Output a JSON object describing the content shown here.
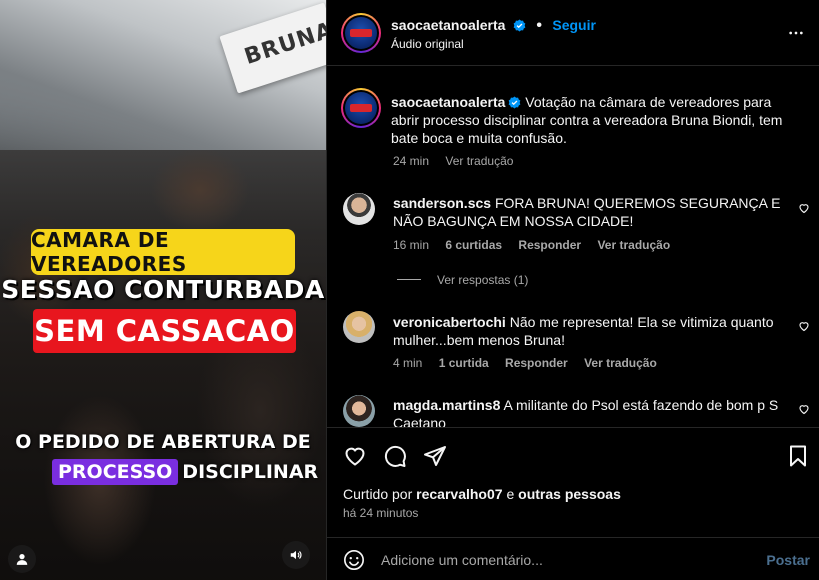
{
  "video": {
    "sign_text": "BRUNA",
    "banner_line1": "CAMARA DE VEREADORES",
    "banner_line2": "SESSAO CONTURBADA",
    "banner_line3": "SEM CASSACAO",
    "caption_line1": "O PEDIDO DE ABERTURA DE",
    "caption_highlight": "PROCESSO",
    "caption_rest": "DISCIPLINAR",
    "user_icon": "user-icon",
    "sound_icon": "speaker-icon"
  },
  "header": {
    "username": "saocaetanoalerta",
    "separator": "•",
    "follow_label": "Seguir",
    "audio_label": "Áudio original",
    "more_icon": "more-horizontal-icon"
  },
  "caption": {
    "username": "saocaetanoalerta",
    "text": "Votação na câmara de vereadores para abrir processo disciplinar contra a vereadora Bruna Biondi, tem bate boca e muita confusão.",
    "time": "24 min",
    "translate": "Ver tradução"
  },
  "comments": [
    {
      "username": "sanderson.scs",
      "text": "FORA BRUNA! QUEREMOS SEGURANÇA E NÃO BAGUNÇA EM NOSSA CIDADE!",
      "time": "16 min",
      "likes": "6 curtidas",
      "reply": "Responder",
      "translate": "Ver tradução",
      "replies_label": "Ver respostas (1)"
    },
    {
      "username": "veronicabertochi",
      "text": "Não me representa! Ela se vitimiza quanto mulher...bem menos Bruna!",
      "time": "4 min",
      "likes": "1 curtida",
      "reply": "Responder",
      "translate": "Ver tradução"
    },
    {
      "username": "magda.martins8",
      "text": "A militante do Psol está fazendo de bom p S Caetano"
    }
  ],
  "actions": {
    "liked_prefix": "Curtido por",
    "liked_user": "recarvalho07",
    "liked_conj": "e",
    "liked_others": "outras pessoas",
    "timestamp": "há 24 minutos"
  },
  "comment_box": {
    "placeholder": "Adicione um comentário...",
    "post_label": "Postar"
  },
  "colors": {
    "accent": "#0095f6",
    "banner_yellow": "#f6d51a",
    "banner_red": "#e8161e",
    "highlight_purple": "#7a2ee0"
  }
}
